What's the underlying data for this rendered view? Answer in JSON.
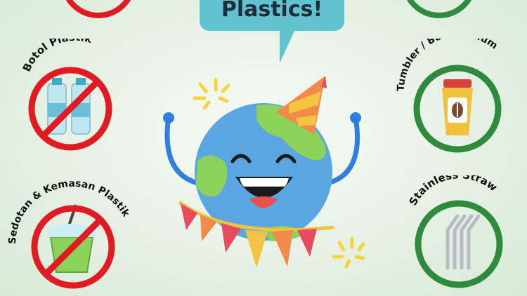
{
  "speech_bubble": {
    "text": "Plastics!"
  },
  "left_items": [
    {
      "label": "Botol Plastik",
      "icon": "plastic-bottles-icon",
      "status": "prohibited"
    },
    {
      "label": "Sedotan & Kemasan Plastik",
      "icon": "plastic-cup-straw-icon",
      "status": "prohibited"
    }
  ],
  "right_items": [
    {
      "label": "Tumbler / Botol Minum",
      "icon": "tumbler-icon",
      "status": "recommended"
    },
    {
      "label": "Stainless Straw",
      "icon": "stainless-straws-icon",
      "status": "recommended"
    }
  ],
  "colors": {
    "prohibited": "#e21b23",
    "recommended": "#2e8b3d",
    "bubble": "#62c3d0",
    "earth_ocean": "#5aa6e3",
    "earth_land": "#8bd35a"
  }
}
